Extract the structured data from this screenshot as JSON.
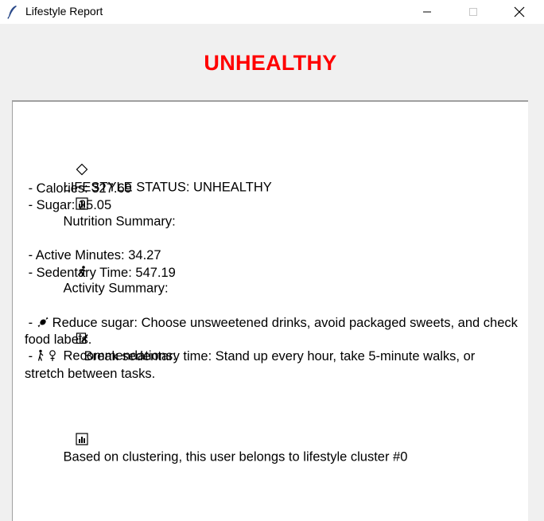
{
  "window": {
    "title": "Lifestyle Report",
    "icon": "feather-icon"
  },
  "heading": {
    "text": "UNHEALTHY",
    "color": "#ff0000"
  },
  "report": {
    "status_line": "LIFESTYLE STATUS: UNHEALTHY",
    "nutrition": {
      "title": "Nutrition Summary:",
      "calories": " - Calories: 327.69",
      "sugar": " - Sugar: 25.05"
    },
    "activity": {
      "title": "Activity Summary:",
      "active_minutes": " - Active Minutes: 34.27",
      "sedentary_time": " - Sedentary Time: 547.19"
    },
    "recommendations": {
      "title": "Recommendations:",
      "items": [
        {
          "prefix": " - ",
          "icon": "candy-icon",
          "text": "Reduce sugar: Choose unsweetened drinks, avoid packaged sweets, and check food labels."
        },
        {
          "prefix": " - ",
          "icon": "walking-woman-icon",
          "text": "Break sedentary time: Stand up every hour, take 5-minute walks, or stretch between tasks."
        }
      ]
    },
    "cluster_line": "Based on clustering, this user belongs to lifestyle cluster #0"
  }
}
